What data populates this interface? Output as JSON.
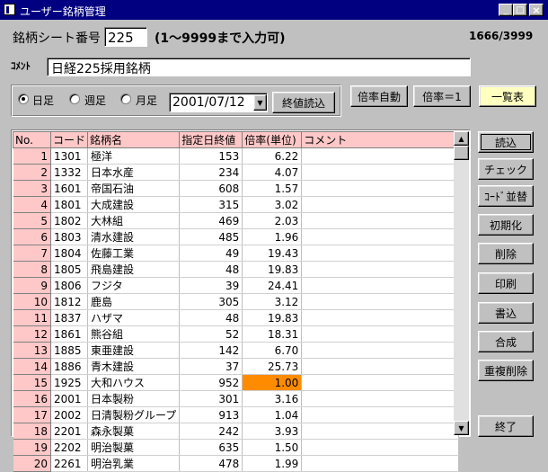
{
  "window": {
    "title": "ユーザー銘柄管理",
    "minimize": "_",
    "maximize": "□",
    "close": "×"
  },
  "sheet": {
    "label": "銘柄シート番号",
    "number": "225",
    "range_note": "(1～9999まで入力可)",
    "counter": "1666/3999"
  },
  "comment": {
    "label": "ｺﾒﾝﾄ",
    "value": "日経225採用銘柄"
  },
  "period": {
    "options": [
      {
        "label": "日足",
        "selected": true
      },
      {
        "label": "週足",
        "selected": false
      },
      {
        "label": "月足",
        "selected": false
      }
    ],
    "date": "2001/07/12",
    "dropdown_arrow": "▼",
    "load_button": "終値読込"
  },
  "ratio_buttons": {
    "auto": "倍率自動",
    "one": "倍率＝1",
    "list": "一覧表"
  },
  "table": {
    "columns": [
      "No.",
      "コード",
      "銘柄名",
      "指定日終値",
      "倍率(単位)",
      "コメント"
    ],
    "rows": [
      {
        "no": "1",
        "code": "1301",
        "name": "極洋",
        "close": "153",
        "ratio": "6.22",
        "comment": ""
      },
      {
        "no": "2",
        "code": "1332",
        "name": "日本水産",
        "close": "234",
        "ratio": "4.07",
        "comment": ""
      },
      {
        "no": "3",
        "code": "1601",
        "name": "帝国石油",
        "close": "608",
        "ratio": "1.57",
        "comment": ""
      },
      {
        "no": "4",
        "code": "1801",
        "name": "大成建設",
        "close": "315",
        "ratio": "3.02",
        "comment": ""
      },
      {
        "no": "5",
        "code": "1802",
        "name": "大林組",
        "close": "469",
        "ratio": "2.03",
        "comment": ""
      },
      {
        "no": "6",
        "code": "1803",
        "name": "清水建設",
        "close": "485",
        "ratio": "1.96",
        "comment": ""
      },
      {
        "no": "7",
        "code": "1804",
        "name": "佐藤工業",
        "close": "49",
        "ratio": "19.43",
        "comment": ""
      },
      {
        "no": "8",
        "code": "1805",
        "name": "飛島建設",
        "close": "48",
        "ratio": "19.83",
        "comment": ""
      },
      {
        "no": "9",
        "code": "1806",
        "name": "フジタ",
        "close": "39",
        "ratio": "24.41",
        "comment": ""
      },
      {
        "no": "10",
        "code": "1812",
        "name": "鹿島",
        "close": "305",
        "ratio": "3.12",
        "comment": ""
      },
      {
        "no": "11",
        "code": "1837",
        "name": "ハザマ",
        "close": "48",
        "ratio": "19.83",
        "comment": ""
      },
      {
        "no": "12",
        "code": "1861",
        "name": "熊谷組",
        "close": "52",
        "ratio": "18.31",
        "comment": ""
      },
      {
        "no": "13",
        "code": "1885",
        "name": "東亜建設",
        "close": "142",
        "ratio": "6.70",
        "comment": ""
      },
      {
        "no": "14",
        "code": "1886",
        "name": "青木建設",
        "close": "37",
        "ratio": "25.73",
        "comment": ""
      },
      {
        "no": "15",
        "code": "1925",
        "name": "大和ハウス",
        "close": "952",
        "ratio": "1.00",
        "comment": "",
        "highlight": true
      },
      {
        "no": "16",
        "code": "2001",
        "name": "日本製粉",
        "close": "301",
        "ratio": "3.16",
        "comment": ""
      },
      {
        "no": "17",
        "code": "2002",
        "name": "日清製粉グループ",
        "close": "913",
        "ratio": "1.04",
        "comment": ""
      },
      {
        "no": "18",
        "code": "2201",
        "name": "森永製菓",
        "close": "242",
        "ratio": "3.93",
        "comment": ""
      },
      {
        "no": "19",
        "code": "2202",
        "name": "明治製菓",
        "close": "635",
        "ratio": "1.50",
        "comment": ""
      },
      {
        "no": "20",
        "code": "2261",
        "name": "明治乳業",
        "close": "478",
        "ratio": "1.99",
        "comment": ""
      }
    ],
    "highlight_color": "#ff8c00",
    "header_color": "#ffc8c8"
  },
  "side_buttons": [
    "読込",
    "チェック",
    "ｺｰﾄﾞ並替",
    "初期化",
    "削除",
    "印刷",
    "書込",
    "合成",
    "重複削除"
  ],
  "exit_button": "終了",
  "scroll": {
    "up": "▲",
    "down": "▼"
  }
}
